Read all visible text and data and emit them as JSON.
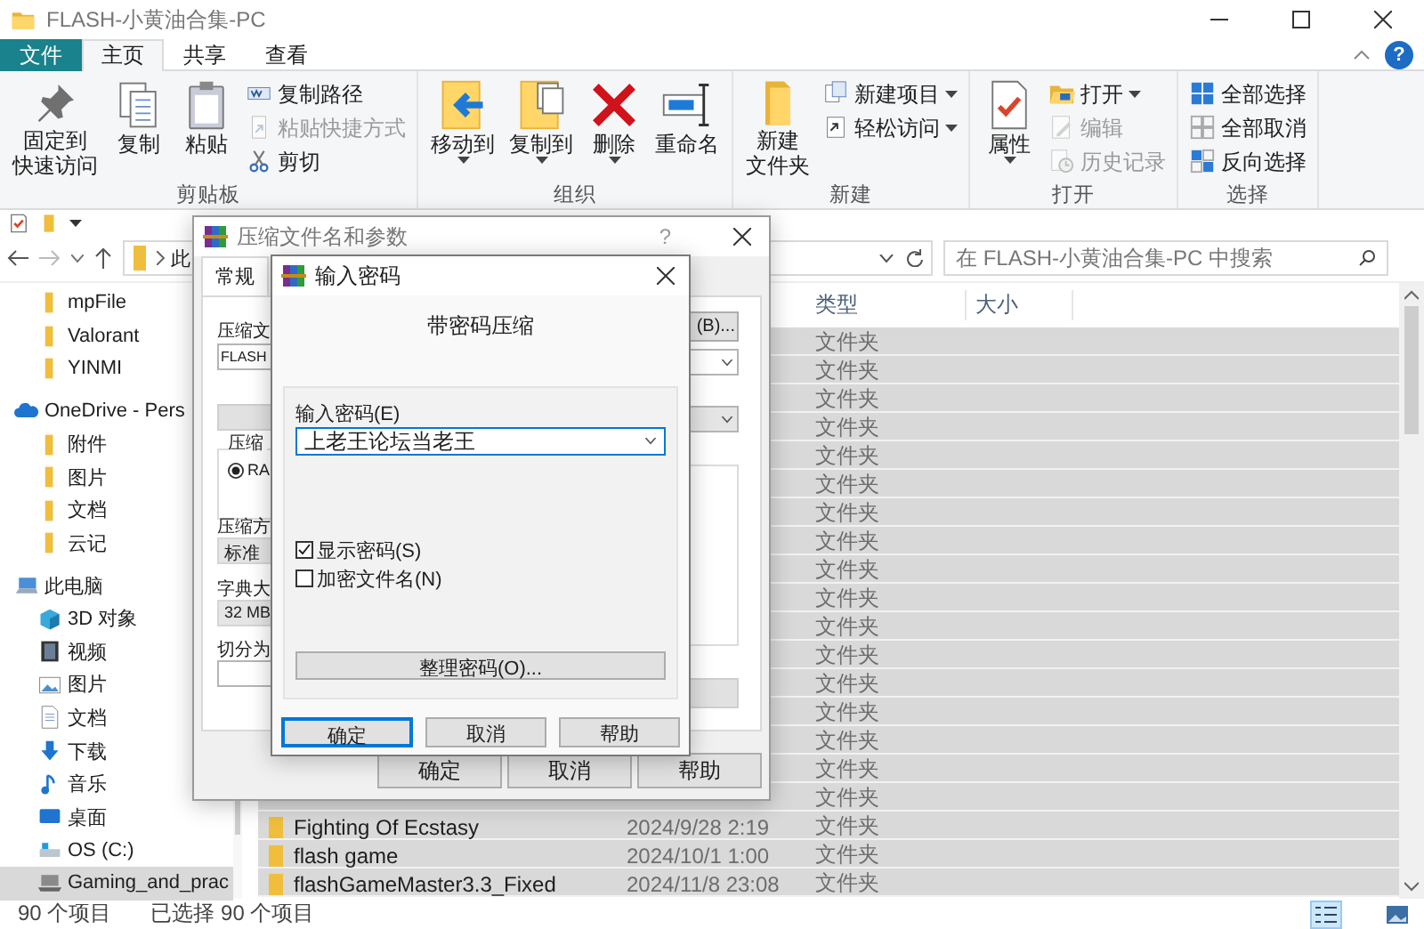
{
  "window": {
    "title": "FLASH-小黄油合集-PC",
    "help": "?"
  },
  "ribbon_tabs": [
    {
      "label": "文件",
      "kind": "file",
      "selected": false
    },
    {
      "label": "主页",
      "kind": "tab",
      "selected": true
    },
    {
      "label": "共享",
      "kind": "tab",
      "selected": false
    },
    {
      "label": "查看",
      "kind": "tab",
      "selected": false
    }
  ],
  "ribbon_groups": [
    {
      "label": "剪贴板",
      "commands": [
        {
          "lines": [
            "固定到",
            "快速访问"
          ],
          "kind": "large",
          "dropdown": false,
          "disabled": false
        },
        {
          "lines": [
            "复制"
          ],
          "kind": "large",
          "dropdown": false,
          "disabled": false
        },
        {
          "lines": [
            "粘贴"
          ],
          "kind": "large",
          "dropdown": false,
          "disabled": false
        },
        {
          "lines": [
            "复制路径"
          ],
          "kind": "small",
          "dropdown": false,
          "disabled": false
        },
        {
          "lines": [
            "粘贴快捷方式"
          ],
          "kind": "small",
          "dropdown": false,
          "disabled": true
        },
        {
          "lines": [
            "剪切"
          ],
          "kind": "small",
          "dropdown": false,
          "disabled": false
        }
      ]
    },
    {
      "label": "组织",
      "commands": [
        {
          "lines": [
            "移动到"
          ],
          "kind": "large",
          "dropdown": true,
          "disabled": false
        },
        {
          "lines": [
            "复制到"
          ],
          "kind": "large",
          "dropdown": true,
          "disabled": false
        },
        {
          "lines": [
            "删除"
          ],
          "kind": "large",
          "dropdown": true,
          "disabled": false
        },
        {
          "lines": [
            "重命名"
          ],
          "kind": "large",
          "dropdown": false,
          "disabled": false
        }
      ]
    },
    {
      "label": "新建",
      "commands": [
        {
          "lines": [
            "新建",
            "文件夹"
          ],
          "kind": "large",
          "dropdown": false,
          "disabled": false
        },
        {
          "lines": [
            "新建项目"
          ],
          "kind": "small",
          "dropdown": true,
          "disabled": false
        },
        {
          "lines": [
            "轻松访问"
          ],
          "kind": "small",
          "dropdown": true,
          "disabled": false
        }
      ]
    },
    {
      "label": "打开",
      "commands": [
        {
          "lines": [
            "属性"
          ],
          "kind": "large",
          "dropdown": true,
          "disabled": false
        },
        {
          "lines": [
            "打开"
          ],
          "kind": "small",
          "dropdown": true,
          "disabled": false
        },
        {
          "lines": [
            "编辑"
          ],
          "kind": "small",
          "dropdown": false,
          "disabled": true
        },
        {
          "lines": [
            "历史记录"
          ],
          "kind": "small",
          "dropdown": false,
          "disabled": true
        }
      ]
    },
    {
      "label": "选择",
      "commands": [
        {
          "lines": [
            "全部选择"
          ],
          "kind": "small",
          "dropdown": false,
          "disabled": false
        },
        {
          "lines": [
            "全部取消"
          ],
          "kind": "small",
          "dropdown": false,
          "disabled": false
        },
        {
          "lines": [
            "反向选择"
          ],
          "kind": "small",
          "dropdown": false,
          "disabled": false
        }
      ]
    }
  ],
  "address_bar": {
    "path": "此",
    "search_placeholder": "在 FLASH-小黄油合集-PC 中搜索"
  },
  "nav_pane": {
    "quick_access_items": [
      {
        "label": "mpFile",
        "kind": "folder",
        "selected": false
      },
      {
        "label": "Valorant",
        "kind": "folder",
        "selected": false
      },
      {
        "label": "YINMI",
        "kind": "folder",
        "selected": false
      }
    ],
    "tree": [
      {
        "label": "OneDrive - Pers",
        "kind": "cloud",
        "selected": false,
        "children": [
          {
            "label": "附件",
            "kind": "folder",
            "selected": false
          },
          {
            "label": "图片",
            "kind": "folder",
            "selected": false
          },
          {
            "label": "文档",
            "kind": "folder",
            "selected": false
          },
          {
            "label": "云记",
            "kind": "folder",
            "selected": false
          }
        ]
      },
      {
        "label": "此电脑",
        "kind": "pc",
        "selected": false,
        "children": [
          {
            "label": "3D 对象",
            "kind": "cube",
            "selected": false
          },
          {
            "label": "视频",
            "kind": "video",
            "selected": false
          },
          {
            "label": "图片",
            "kind": "picture",
            "selected": false
          },
          {
            "label": "文档",
            "kind": "document",
            "selected": false
          },
          {
            "label": "下载",
            "kind": "download",
            "selected": false
          },
          {
            "label": "音乐",
            "kind": "music",
            "selected": false
          },
          {
            "label": "桌面",
            "kind": "desktop",
            "selected": false
          },
          {
            "label": "OS (C:)",
            "kind": "drive",
            "selected": false
          },
          {
            "label": "Gaming_and_prac",
            "kind": "laptop",
            "selected": true
          }
        ]
      }
    ]
  },
  "file_list": {
    "columns": [
      "类型",
      "大小"
    ],
    "rows": [
      {
        "type": "文件夹",
        "selected": true
      },
      {
        "type": "文件夹",
        "selected": true
      },
      {
        "type": "文件夹",
        "selected": true
      },
      {
        "type": "文件夹",
        "selected": true
      },
      {
        "type": "文件夹",
        "selected": true
      },
      {
        "type": "文件夹",
        "selected": true
      },
      {
        "type": "文件夹",
        "selected": true
      },
      {
        "type": "文件夹",
        "selected": true
      },
      {
        "type": "文件夹",
        "selected": true
      },
      {
        "type": "文件夹",
        "selected": true
      },
      {
        "type": "文件夹",
        "selected": true
      },
      {
        "type": "文件夹",
        "selected": true
      },
      {
        "type": "文件夹",
        "selected": true
      },
      {
        "type": "文件夹",
        "selected": true
      },
      {
        "type": "文件夹",
        "selected": true
      },
      {
        "type": "文件夹",
        "selected": true
      },
      {
        "type": "文件夹",
        "selected": true
      },
      {
        "name": "Fighting Of Ecstasy",
        "modified": "2024/9/28 2:19",
        "type": "文件夹",
        "selected": true
      },
      {
        "name": "flash game",
        "modified": "2024/10/1 1:00",
        "type": "文件夹",
        "selected": true
      },
      {
        "name": "flashGameMaster3.3_Fixed",
        "modified": "2024/11/8 23:08",
        "type": "文件夹",
        "selected": true
      }
    ]
  },
  "status_bar": {
    "item_count": "90 个项目",
    "selection": "已选择 90 个项目",
    "views": [
      {
        "selected": true
      },
      {
        "selected": false
      }
    ]
  },
  "archive_dialog": {
    "title": "压缩文件名和参数",
    "help": "?",
    "tabs": [
      {
        "label": "常规",
        "selected": true
      }
    ],
    "archive_name_label": "压缩文",
    "archive_name": "FLASH",
    "browse_button": "(B)...",
    "format_group": "压缩",
    "format_options": [
      {
        "label": "RA",
        "selected": true
      }
    ],
    "method_label": "压缩方",
    "method": "标准",
    "dictionary_label": "字典大",
    "dictionary": "32 MB",
    "split_label": "切分为",
    "buttons": [
      "确定",
      "取消",
      "帮助"
    ]
  },
  "password_dialog": {
    "title": "输入密码",
    "heading": "带密码压缩",
    "password_label": "输入密码(E)",
    "password": "上老王论坛当老王",
    "options": [
      {
        "label": "显示密码(S)",
        "checked": true
      },
      {
        "label": "加密文件名(N)",
        "checked": false
      }
    ],
    "organize_button": "整理密码(O)...",
    "buttons": [
      {
        "label": "确定",
        "focused": true
      },
      {
        "label": "取消",
        "focused": false
      },
      {
        "label": "帮助",
        "focused": false
      }
    ]
  }
}
